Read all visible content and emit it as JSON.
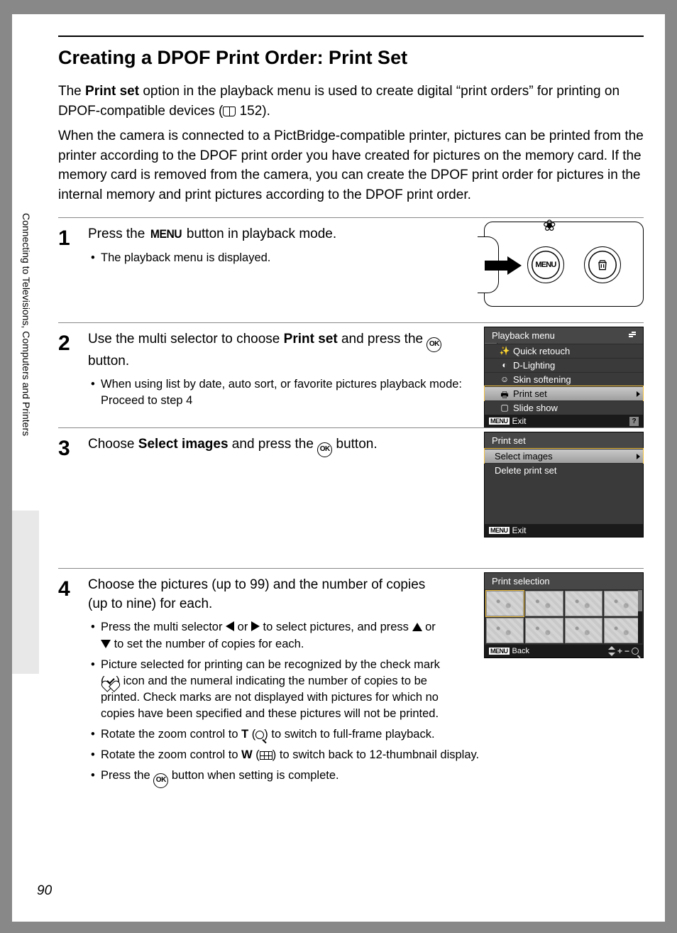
{
  "page_number": "90",
  "sidebar_label": "Connecting to Televisions, Computers and Printers",
  "title": "Creating a DPOF Print Order: Print Set",
  "intro": {
    "p1a": "The ",
    "p1b": "Print set",
    "p1c": " option in the playback menu is used to create digital “print orders” for printing on DPOF-compatible devices (",
    "p1d": " 152).",
    "p2": "When the camera is connected to a PictBridge-compatible printer, pictures can be printed from the printer according to the DPOF print order you have created for pictures on the memory card. If the memory card is removed from the camera, you can create the DPOF print order for pictures in the internal memory and print pictures according to the DPOF print order."
  },
  "icon_labels": {
    "menu": "MENU",
    "ok": "OK",
    "tele": "T",
    "wide": "W"
  },
  "steps": {
    "s1": {
      "num": "1",
      "heading_a": "Press the ",
      "heading_b": " button in playback mode.",
      "bullet1": "The playback menu is displayed."
    },
    "s2": {
      "num": "2",
      "heading_a": "Use the multi selector to choose ",
      "heading_bold": "Print set",
      "heading_b": " and press the ",
      "heading_c": " button.",
      "bullet1": "When using list by date, auto sort, or favorite pictures playback mode: Proceed to step 4"
    },
    "s3": {
      "num": "3",
      "heading_a": "Choose ",
      "heading_bold": "Select images",
      "heading_b": " and press the ",
      "heading_c": " button."
    },
    "s4": {
      "num": "4",
      "heading": "Choose the pictures (up to 99) and the number of copies (up to nine) for each.",
      "b1a": "Press the multi selector ",
      "b1b": " or ",
      "b1c": " to select pictures, and press ",
      "b1d": " or ",
      "b1e": " to set the number of copies for each.",
      "b2a": "Picture selected for printing can be recognized by the check mark (",
      "b2b": ") icon and the numeral indicating the number of copies to be printed. Check marks are not displayed with pictures for which no copies have been specified and these pictures will not be printed.",
      "b3a": "Rotate the zoom control to ",
      "b3b": " (",
      "b3c": ") to switch to full-frame playback.",
      "b4a": "Rotate the zoom control to ",
      "b4b": " (",
      "b4c": ") to switch back to 12-thumbnail display.",
      "b5a": "Press the ",
      "b5b": " button when setting is complete."
    }
  },
  "lcd2": {
    "title": "Playback menu",
    "items": [
      "Quick retouch",
      "D-Lighting",
      "Skin softening",
      "Print set",
      "Slide show"
    ],
    "selected_index": 3,
    "footer": "Exit",
    "footer_menu": "MENU",
    "help": "?"
  },
  "lcd3": {
    "title": "Print set",
    "items": [
      "Select images",
      "Delete print set"
    ],
    "selected_index": 0,
    "footer": "Exit",
    "footer_menu": "MENU"
  },
  "lcd4": {
    "title": "Print selection",
    "footer": "Back",
    "footer_menu": "MENU"
  }
}
